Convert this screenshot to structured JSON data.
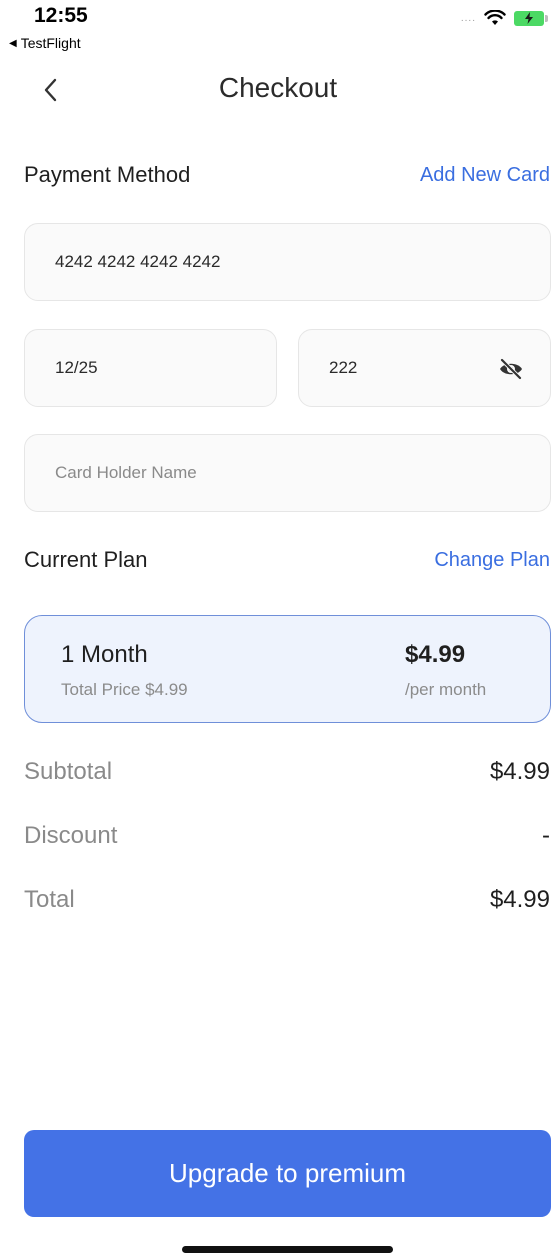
{
  "status_bar": {
    "time": "12:55",
    "back_app": "TestFlight",
    "signal_dots": "....",
    "wifi_icon": "wifi-icon",
    "battery_icon": "battery-charging-icon",
    "battery_color": "#4cd964"
  },
  "header": {
    "title": "Checkout",
    "back_icon": "chevron-left-icon"
  },
  "payment": {
    "label": "Payment Method",
    "add_card_link": "Add New Card",
    "card_number": "4242 4242 4242 4242",
    "expiry": "12/25",
    "cvv": "222",
    "cvv_icon": "eye-slash-icon",
    "holder_placeholder": "Card Holder Name"
  },
  "plan": {
    "label": "Current Plan",
    "change_link": "Change Plan",
    "name": "1 Month",
    "total_text": "Total Price $4.99",
    "price": "$4.99",
    "period": "/per month"
  },
  "summary": {
    "subtotal_label": "Subtotal",
    "subtotal_value": "$4.99",
    "discount_label": "Discount",
    "discount_value": "-",
    "total_label": "Total",
    "total_value": "$4.99"
  },
  "cta": {
    "label": "Upgrade to premium"
  },
  "colors": {
    "accent": "#4472e6",
    "link": "#3a6ee0",
    "plan_bg": "#eef3fd",
    "plan_border": "#6f8fd9"
  }
}
